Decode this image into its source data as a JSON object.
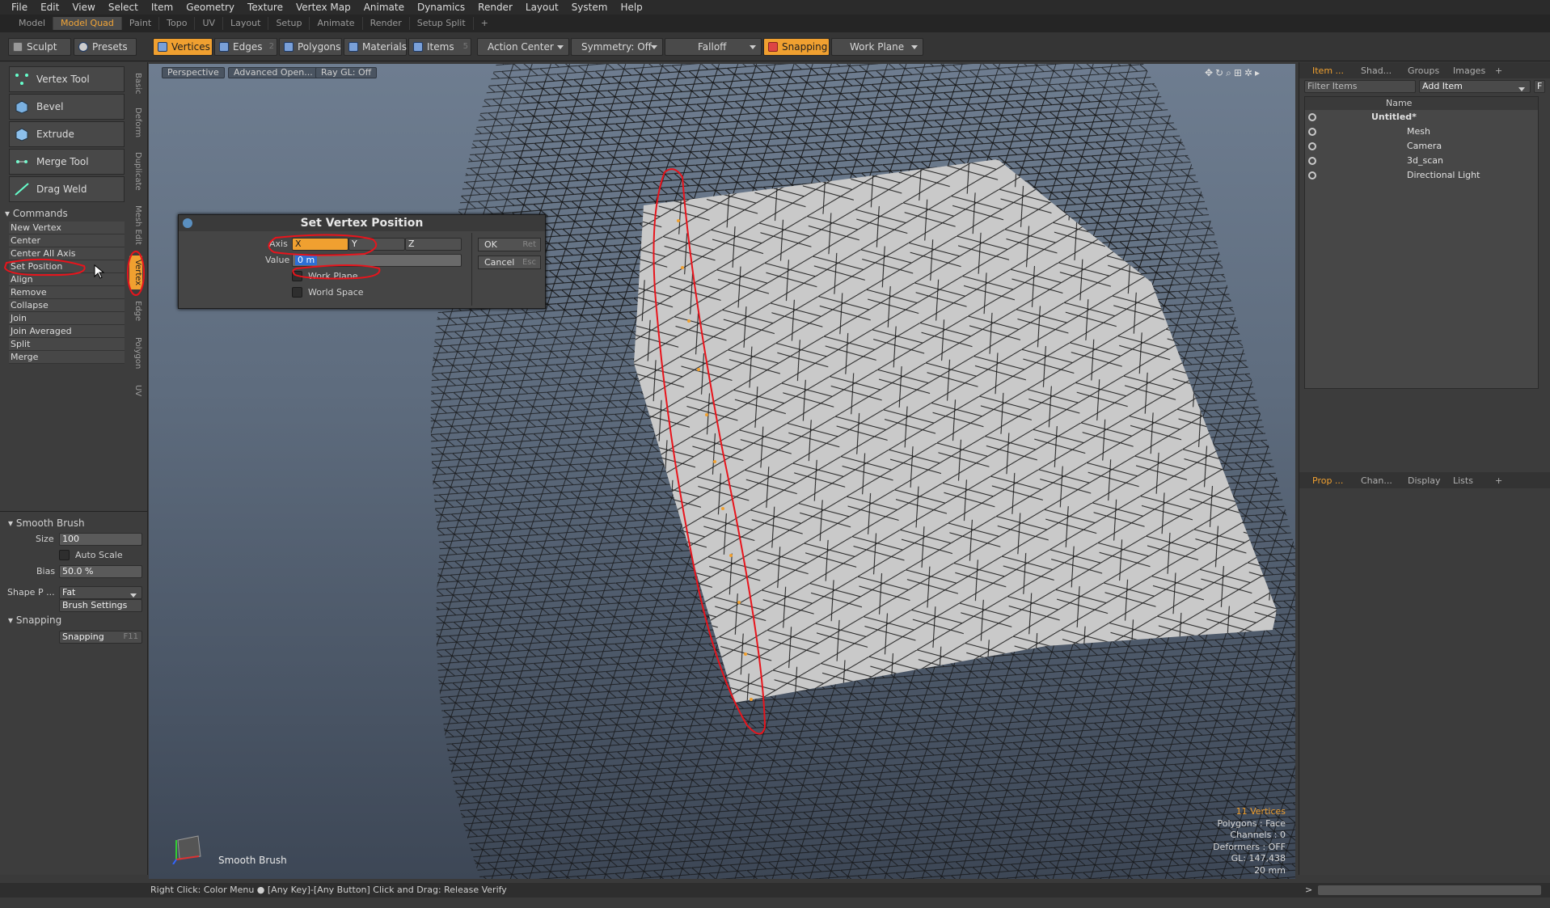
{
  "menu": [
    "File",
    "Edit",
    "View",
    "Select",
    "Item",
    "Geometry",
    "Texture",
    "Vertex Map",
    "Animate",
    "Dynamics",
    "Render",
    "Layout",
    "System",
    "Help"
  ],
  "layout_tabs": {
    "items": [
      "Model",
      "Model Quad",
      "Paint",
      "Topo",
      "UV",
      "Layout",
      "Setup",
      "Animate",
      "Render",
      "Setup Split",
      "+"
    ],
    "active": "Model Quad"
  },
  "toolbar": {
    "sculpt": "Sculpt",
    "presets": "Presets",
    "vertices": "Vertices",
    "edges": "Edges",
    "edges_count": "2",
    "polygons": "Polygons",
    "materials": "Materials",
    "items": "Items",
    "items_count": "5",
    "action_center": "Action Center",
    "symmetry": "Symmetry: Off",
    "falloff": "Falloff",
    "snapping": "Snapping",
    "work_plane": "Work Plane"
  },
  "tools": [
    "Vertex Tool",
    "Bevel",
    "Extrude",
    "Merge Tool",
    "Drag Weld"
  ],
  "commands": {
    "header": "Commands",
    "items": [
      "New Vertex",
      "Center",
      "Center All Axis",
      "Set Position",
      "Align",
      "Remove",
      "Collapse",
      "Join",
      "Join Averaged",
      "Split",
      "Merge"
    ]
  },
  "vertical_tabs": [
    "Basic",
    "Deform",
    "Duplicate",
    "Mesh Edit",
    "Vertex",
    "Edge",
    "Polygon",
    "UV"
  ],
  "smooth_brush": {
    "header": "Smooth Brush",
    "size_label": "Size",
    "size_value": "100",
    "auto_scale": "Auto Scale",
    "bias_label": "Bias",
    "bias_value": "50.0 %",
    "shape_label": "Shape P ...",
    "shape_value": "Fat",
    "brush_settings": "Brush Settings"
  },
  "snapping_section": {
    "header": "Snapping",
    "button": "Snapping",
    "shortcut": "F11"
  },
  "viewport": {
    "perspective": "Perspective",
    "advanced": "Advanced Open...",
    "raygl": "Ray GL: Off",
    "tool_label": "Smooth Brush",
    "info": [
      "11 Vertices",
      "Polygons : Face",
      "Channels : 0",
      "Deformers : OFF",
      "GL: 147,438",
      "20 mm"
    ]
  },
  "dialog": {
    "title": "Set Vertex Position",
    "axis_label": "Axis",
    "axis_x": "X",
    "axis_y": "Y",
    "axis_z": "Z",
    "value_label": "Value",
    "value": "0 m",
    "work_plane": "Work Plane",
    "world_space": "World Space",
    "ok": "OK",
    "ok_shortcut": "Ret",
    "cancel": "Cancel",
    "cancel_shortcut": "Esc"
  },
  "items_panel": {
    "tabs": [
      "Item ...",
      "Shad...",
      "Groups",
      "Images",
      "+"
    ],
    "filter_placeholder": "Filter Items",
    "add_item": "Add Item",
    "f_btn": "F",
    "name_col": "Name",
    "rows": [
      "Untitled*",
      "Mesh",
      "Camera",
      "3d_scan",
      "Directional Light"
    ]
  },
  "props_panel": {
    "tabs": [
      "Prop ...",
      "Chan...",
      "Display",
      "Lists",
      "+"
    ]
  },
  "status": {
    "text": "Right Click: Color Menu ● [Any Key]-[Any Button] Click and Drag: Release Verify",
    "prompt": ">"
  },
  "colors": {
    "accent": "#f0a030",
    "annotation": "#e8141c"
  }
}
